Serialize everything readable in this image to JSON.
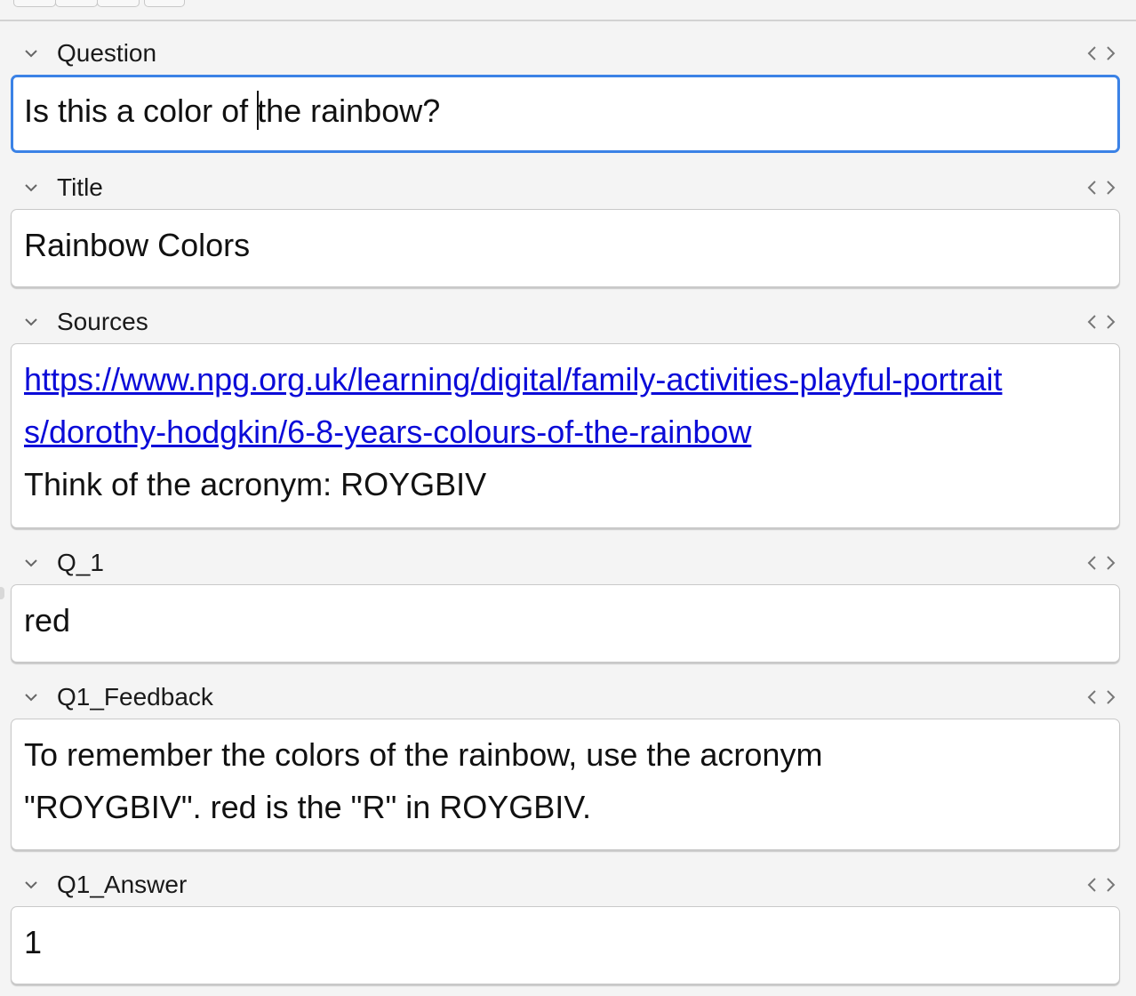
{
  "fields": [
    {
      "label": "Question",
      "value_before_caret": "Is this a color of",
      "value_after_caret": "the rainbow?"
    },
    {
      "label": "Title",
      "value": "Rainbow Colors"
    },
    {
      "label": "Sources",
      "link": "https://www.npg.org.uk/learning/digital/family-activities-playful-portraits/dorothy-hodgkin/6-8-years-colours-of-the-rainbow",
      "note": "Think of the acronym: ROYGBIV"
    },
    {
      "label": "Q_1",
      "value": "red"
    },
    {
      "label": "Q1_Feedback",
      "value": "To remember the colors of the rainbow, use the acronym \"ROYGBIV\". red is the \"R\" in ROYGBIV."
    },
    {
      "label": "Q1_Answer",
      "value": "1"
    }
  ],
  "icons": {
    "collapse": "chevron-down-icon",
    "html_editor": "code-brackets-icon"
  },
  "colors": {
    "focus_border": "#3b82e6",
    "link": "#0b0bd8"
  }
}
